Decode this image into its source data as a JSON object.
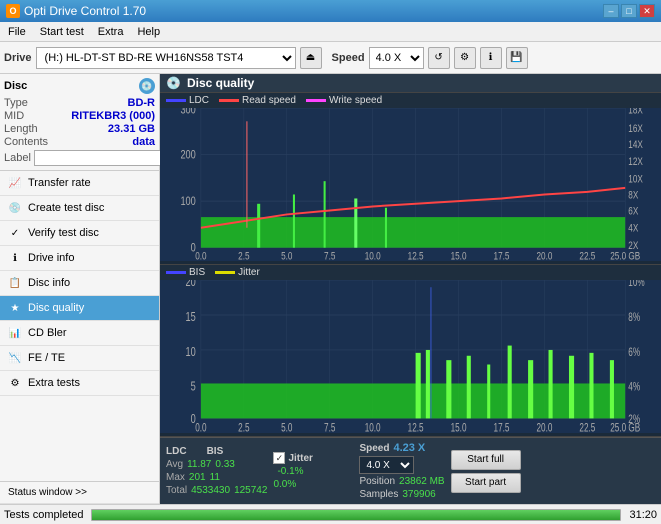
{
  "titlebar": {
    "title": "Opti Drive Control 1.70",
    "icon": "O",
    "minimize": "–",
    "maximize": "□",
    "close": "✕"
  },
  "menubar": {
    "items": [
      "File",
      "Start test",
      "Extra",
      "Help"
    ]
  },
  "toolbar": {
    "drive_label": "Drive",
    "drive_value": "(H:) HL-DT-ST BD-RE  WH16NS58 TST4",
    "speed_label": "Speed",
    "speed_value": "4.0 X"
  },
  "disc": {
    "header": "Disc",
    "type_label": "Type",
    "type_value": "BD-R",
    "mid_label": "MID",
    "mid_value": "RITEKBR3 (000)",
    "length_label": "Length",
    "length_value": "23.31 GB",
    "contents_label": "Contents",
    "contents_value": "data",
    "label_label": "Label",
    "label_placeholder": ""
  },
  "nav": {
    "items": [
      {
        "id": "transfer-rate",
        "label": "Transfer rate",
        "icon": "📈"
      },
      {
        "id": "create-test-disc",
        "label": "Create test disc",
        "icon": "💿"
      },
      {
        "id": "verify-test-disc",
        "label": "Verify test disc",
        "icon": "✓"
      },
      {
        "id": "drive-info",
        "label": "Drive info",
        "icon": "ℹ"
      },
      {
        "id": "disc-info",
        "label": "Disc info",
        "icon": "📋"
      },
      {
        "id": "disc-quality",
        "label": "Disc quality",
        "icon": "★",
        "active": true
      },
      {
        "id": "cd-bler",
        "label": "CD Bler",
        "icon": "📊"
      },
      {
        "id": "fe-te",
        "label": "FE / TE",
        "icon": "📉"
      },
      {
        "id": "extra-tests",
        "label": "Extra tests",
        "icon": "⚙"
      }
    ]
  },
  "status_window": "Status window >>",
  "content": {
    "title": "Disc quality",
    "chart1": {
      "legend": [
        {
          "label": "LDC",
          "color": "#0000ff"
        },
        {
          "label": "Read speed",
          "color": "#ff0000"
        },
        {
          "label": "Write speed",
          "color": "#ff00ff"
        }
      ],
      "y_max": 300,
      "y_labels": [
        "300",
        "200",
        "100",
        "0"
      ],
      "y_right": [
        "18X",
        "16X",
        "14X",
        "12X",
        "10X",
        "8X",
        "6X",
        "4X",
        "2X"
      ],
      "x_labels": [
        "0.0",
        "2.5",
        "5.0",
        "7.5",
        "10.0",
        "12.5",
        "15.0",
        "17.5",
        "20.0",
        "22.5",
        "25.0 GB"
      ]
    },
    "chart2": {
      "legend": [
        {
          "label": "BIS",
          "color": "#0000ff"
        },
        {
          "label": "Jitter",
          "color": "#ffff00"
        }
      ],
      "y_max": 20,
      "y_labels": [
        "20",
        "15",
        "10",
        "5",
        "0"
      ],
      "y_right": [
        "10%",
        "8%",
        "6%",
        "4%",
        "2%"
      ],
      "x_labels": [
        "0.0",
        "2.5",
        "5.0",
        "7.5",
        "10.0",
        "12.5",
        "15.0",
        "17.5",
        "20.0",
        "22.5",
        "25.0 GB"
      ]
    }
  },
  "stats": {
    "ldc_label": "LDC",
    "bis_label": "BIS",
    "jitter_label": "Jitter",
    "speed_label": "Speed",
    "avg_label": "Avg",
    "max_label": "Max",
    "total_label": "Total",
    "ldc_avg": "11.87",
    "ldc_max": "201",
    "ldc_total": "4533430",
    "bis_avg": "0.33",
    "bis_max": "11",
    "bis_total": "125742",
    "jitter_avg": "-0.1%",
    "jitter_max": "0.0%",
    "speed_val": "4.23 X",
    "speed_select": "4.0 X",
    "position_label": "Position",
    "position_val": "23862 MB",
    "samples_label": "Samples",
    "samples_val": "379906",
    "start_full": "Start full",
    "start_part": "Start part"
  },
  "statusbar": {
    "text": "Tests completed",
    "progress": 100,
    "time": "31:20"
  }
}
